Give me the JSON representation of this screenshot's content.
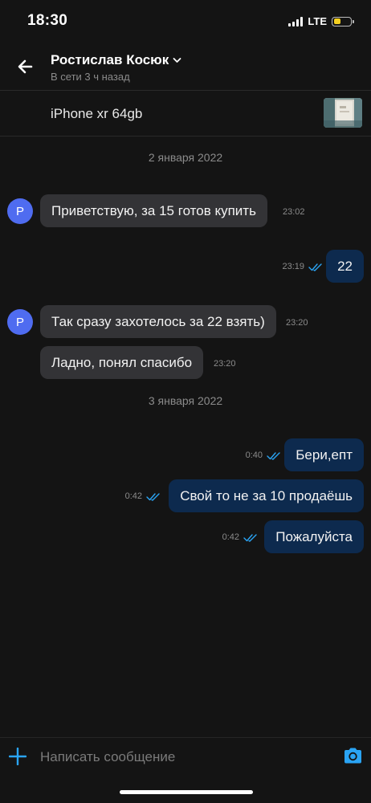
{
  "status_bar": {
    "time": "18:30",
    "network": "LTE",
    "battery_level": 0.45
  },
  "header": {
    "contact_name": "Ростислав Косюк",
    "online_status": "В сети 3 ч назад"
  },
  "product": {
    "title": "iPhone xr 64gb"
  },
  "messages": {
    "date_1": "2 января 2022",
    "date_2": "3 января 2022",
    "m1": {
      "text": "Приветствую, за 15 готов купить",
      "time": "23:02",
      "avatar": "Р"
    },
    "m2": {
      "text": "22",
      "time": "23:19"
    },
    "m3": {
      "text": "Так сразу захотелось за 22 взять)",
      "time": "23:20",
      "avatar": "Р"
    },
    "m4": {
      "text": "Ладно, понял спасибо",
      "time": "23:20"
    },
    "m5": {
      "text": "Бери,епт",
      "time": "0:40"
    },
    "m6": {
      "text": "Свой то не за 10 продаёшь",
      "time": "0:42"
    },
    "m7": {
      "text": "Пожалуйста",
      "time": "0:42"
    }
  },
  "composer": {
    "placeholder": "Написать сообщение"
  },
  "colors": {
    "accent": "#2aa4f4",
    "avatar": "#4f6cf0",
    "outgoing_bubble": "#0d2a4e",
    "incoming_bubble": "#333336"
  }
}
